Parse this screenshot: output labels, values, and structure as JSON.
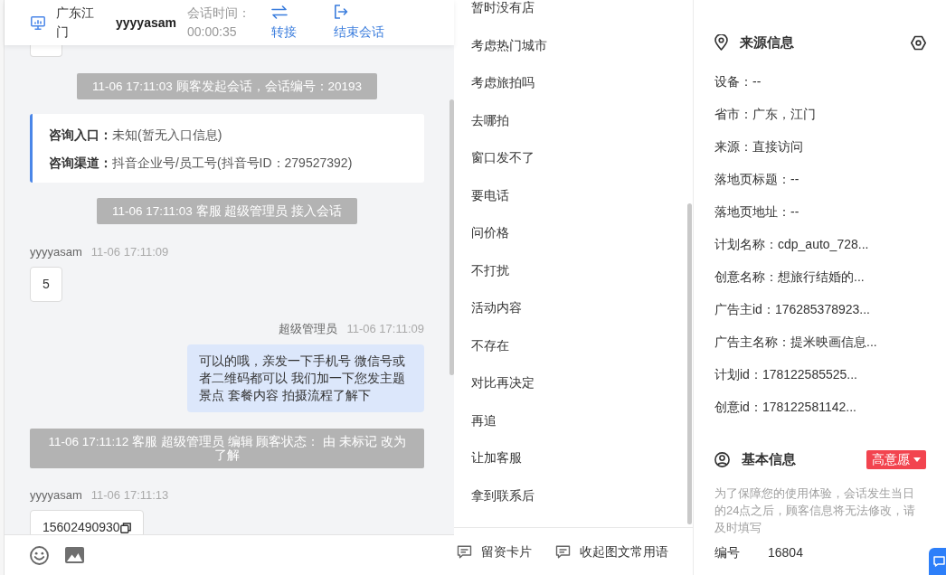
{
  "chat_header": {
    "region": "广东江门",
    "customer_name": "yyyyasam",
    "session_time_label": "会话时间：",
    "session_time": "00:00:35",
    "actions": [
      {
        "kind": "transfer",
        "label": "转接"
      },
      {
        "kind": "end_session",
        "label": "结束会话"
      }
    ]
  },
  "messages": [
    {
      "kind": "customer_clipped"
    },
    {
      "kind": "notice",
      "text": "11-06 17:11:03 顾客发起会话，会话编号：20193"
    },
    {
      "kind": "info_card",
      "rows": [
        {
          "label": "咨询入口：",
          "value": "未知(暂无入口信息)"
        },
        {
          "label": "咨询渠道：",
          "value": "抖音企业号/员工号(抖音号ID：279527392)"
        }
      ]
    },
    {
      "kind": "notice",
      "text": "11-06 17:11:03 客服 超级管理员 接入会话"
    },
    {
      "kind": "customer",
      "sender": "yyyyasam",
      "time": "11-06 17:11:09",
      "text": "5",
      "copyable": false
    },
    {
      "kind": "agent",
      "sender": "超级管理员",
      "time": "11-06 17:11:09",
      "text": "可以的哦，亲发一下手机号 微信号或者二维码都可以 我们加一下您发主题景点 套餐内容 拍摄流程了解下"
    },
    {
      "kind": "notice",
      "text": "11-06 17:11:12 客服 超级管理员 编辑 顾客状态： 由 未标记 改为了解"
    },
    {
      "kind": "customer",
      "sender": "yyyyasam",
      "time": "11-06 17:11:13",
      "text": "15602490930",
      "copyable": true
    }
  ],
  "quick_replies": {
    "items": [
      "暂时没有店",
      "考虑热门城市",
      "考虑旅拍吗",
      "去哪拍",
      "窗口发不了",
      "要电话",
      "问价格",
      "不打扰",
      "活动内容",
      "不存在",
      "对比再决定",
      "再追",
      "让加客服",
      "拿到联系后"
    ],
    "buttons": [
      "留资卡片",
      "收起图文常用语"
    ]
  },
  "source_info": {
    "title": "来源信息",
    "fields": [
      "设备：--",
      "省市：广东，江门",
      "来源：直接访问",
      "落地页标题：--",
      "落地页地址：--",
      "计划名称：cdp_auto_728...",
      "创意名称：想旅行结婚的...",
      "广告主id：176285378923...",
      "广告主名称：提米映画信息...",
      "计划id：178122585525...",
      "创意id：178122581142..."
    ]
  },
  "basic_info": {
    "title": "基本信息",
    "intent_tag": "高意愿",
    "note": "为了保障您的使用体验，会话发生当日的24点之后，顾客信息将无法修改，请及时填写",
    "fields": [
      {
        "label": "编号",
        "value": "16804"
      }
    ]
  }
}
